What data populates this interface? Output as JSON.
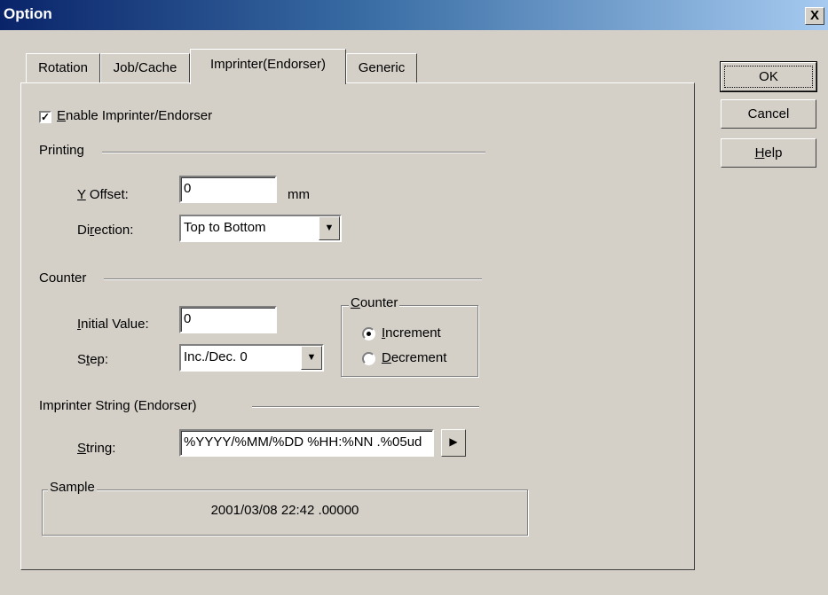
{
  "window": {
    "title": "Option",
    "close_glyph": "X"
  },
  "tabs": [
    {
      "label": "Rotation"
    },
    {
      "label": "Job/Cache"
    },
    {
      "label": "Imprinter(Endorser)"
    },
    {
      "label": "Generic"
    }
  ],
  "buttons": {
    "ok": "OK",
    "cancel": "Cancel",
    "help_prefix": "",
    "help_u": "H",
    "help_rest": "elp"
  },
  "enable": {
    "checked": true,
    "check_mark": "✓",
    "u": "E",
    "rest": "nable Imprinter/Endorser"
  },
  "printing": {
    "title": "Printing",
    "y_offset_u": "Y",
    "y_offset_rest": " Offset:",
    "y_offset_value": "0",
    "unit": "mm",
    "direction_pre": "Di",
    "direction_u": "r",
    "direction_rest": "ection:",
    "direction_value": "Top to Bottom"
  },
  "counter": {
    "title": "Counter",
    "initial_u": "I",
    "initial_rest": "nitial Value:",
    "initial_value": "0",
    "step_pre": "S",
    "step_u": "t",
    "step_rest": "ep:",
    "step_value": "Inc./Dec. 0",
    "group_u": "C",
    "group_rest": "ounter",
    "increment_u": "I",
    "increment_rest": "ncrement",
    "decrement_u": "D",
    "decrement_rest": "ecrement",
    "selected": "Increment"
  },
  "imprinter": {
    "title": "Imprinter String (Endorser)",
    "string_u": "S",
    "string_rest": "tring:",
    "string_value": "%YYYY/%MM/%DD %HH:%NN .%05ud",
    "arrow_glyph": "▶"
  },
  "sample": {
    "title": "Sample",
    "value": "2001/03/08 22:42 .00000"
  },
  "icons": {
    "dropdown": "▼"
  }
}
